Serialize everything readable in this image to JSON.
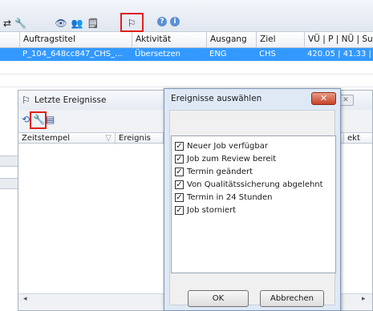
{
  "toolbar": {
    "icons": [
      "swap-icon",
      "wrench-icon",
      "eye-icon",
      "users-icon",
      "note-icon",
      "events-icon",
      "help-icon",
      "info-icon"
    ],
    "glyphs": {
      "swap": "⇄",
      "wrench": "🔧",
      "eye": "👁",
      "users": "👥",
      "note": "🗒",
      "events": "⚐",
      "help": "?",
      "info": "i"
    },
    "highlight_color": "#e0201a"
  },
  "grid": {
    "columns": [
      "Auftragstitel",
      "Aktivität",
      "Ausgang",
      "Ziel",
      "VÜ | P | NÜ | Su"
    ],
    "rows": [
      [
        "P_104_648cc847_CHS_...",
        "Übersetzen",
        "ENG",
        "CHS",
        "420.05 | 41.33 |"
      ]
    ],
    "selection_color": "#3399ff"
  },
  "events_window": {
    "title": "Letzte Ereignisse",
    "columns": [
      "Zeitstempel",
      "Ereignis",
      "ekt"
    ],
    "scroll_left": "◂",
    "scroll_right": "▸",
    "inactive_close": "✕"
  },
  "dialog": {
    "title": "Ereignisse auswählen",
    "close_glyph": "✕",
    "checkmark": "✓",
    "options": [
      {
        "label": "Neuer Job verfügbar",
        "checked": true
      },
      {
        "label": "Job zum Review bereit",
        "checked": true
      },
      {
        "label": "Termin geändert",
        "checked": true
      },
      {
        "label": "Von Qualitätssicherung abgelehnt",
        "checked": true
      },
      {
        "label": "Termin in 24 Stunden",
        "checked": true
      },
      {
        "label": "Job storniert",
        "checked": true
      }
    ],
    "ok_label": "OK",
    "cancel_label": "Abbrechen",
    "close_color": "#c7432a"
  }
}
